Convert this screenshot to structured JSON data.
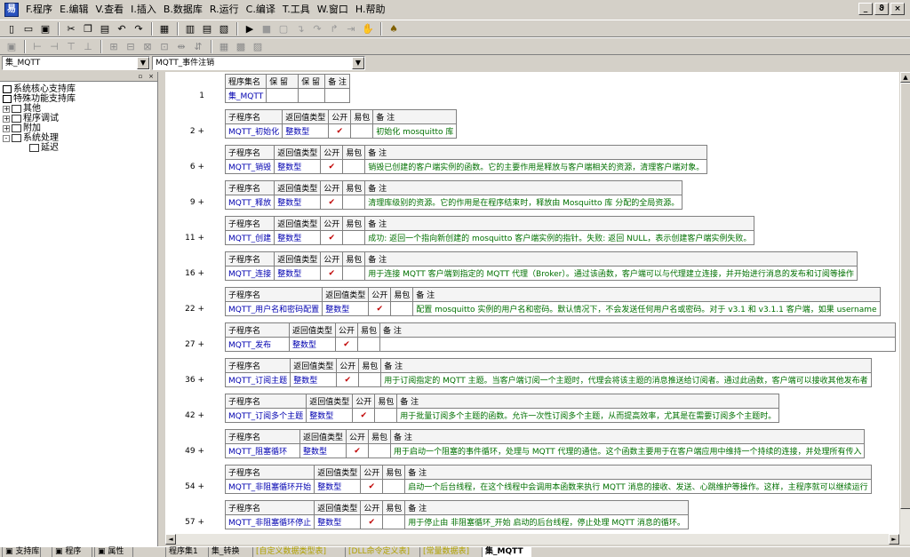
{
  "menubar": {
    "icon": "app-logo-icon",
    "items": [
      "F.程序",
      "E.编辑",
      "V.查看",
      "I.插入",
      "B.数据库",
      "R.运行",
      "C.编译",
      "T.工具",
      "W.窗口",
      "H.帮助"
    ],
    "window_controls": [
      "_",
      "ϑ",
      "×"
    ]
  },
  "combos": {
    "left": "集_MQTT",
    "right": "MQTT_事件注销"
  },
  "tree": {
    "items": [
      {
        "label": "系统核心支持库",
        "level": 0,
        "expander": ""
      },
      {
        "label": "特殊功能支持库",
        "level": 0,
        "expander": ""
      },
      {
        "label": "其他",
        "level": 0,
        "expander": "+"
      },
      {
        "label": "程序调试",
        "level": 0,
        "expander": "+"
      },
      {
        "label": "附加",
        "level": 0,
        "expander": "+"
      },
      {
        "label": "系统处理",
        "level": 0,
        "expander": "-"
      },
      {
        "label": "延迟",
        "level": 1,
        "expander": ""
      }
    ]
  },
  "editor": {
    "set_header": [
      "程序集名",
      "保 留",
      "保 留",
      "备 注"
    ],
    "set_row": {
      "line": "1",
      "name": "集_MQTT"
    },
    "sub_header": [
      "子程序名",
      "返回值类型",
      "公开",
      "易包",
      "备 注"
    ],
    "check_mark": "✔",
    "subs": [
      {
        "line": "2 +",
        "name": "MQTT_初始化",
        "ret": "整数型",
        "note": "初始化 mosquitto 库"
      },
      {
        "line": "6 +",
        "name": "MQTT_销毁",
        "ret": "整数型",
        "note": "销毁已创建的客户端实例的函数。它的主要作用是释放与客户端相关的资源，清理客户端对象。"
      },
      {
        "line": "9 +",
        "name": "MQTT_释放",
        "ret": "整数型",
        "note": "清理库级别的资源。它的作用是在程序结束时，释放由 Mosquitto 库 分配的全局资源。"
      },
      {
        "line": "11 +",
        "name": "MQTT_创建",
        "ret": "整数型",
        "note": "成功: 返回一个指向新创建的 mosquitto 客户端实例的指针。失败: 返回 NULL，表示创建客户端实例失败。"
      },
      {
        "line": "16 +",
        "name": "MQTT_连接",
        "ret": "整数型",
        "note": "用于连接 MQTT 客户端到指定的 MQTT 代理（Broker）。通过该函数，客户端可以与代理建立连接，并开始进行消息的发布和订阅等操作"
      },
      {
        "line": "22 +",
        "name": "MQTT_用户名和密码配置",
        "ret": "整数型",
        "note": "配置 mosquitto 实例的用户名和密码。默认情况下，不会发送任何用户名或密码。对于 v3.1 和 v3.1.1 客户端，如果 username"
      },
      {
        "line": "27 +",
        "name": "MQTT_发布",
        "ret": "整数型",
        "note": ""
      },
      {
        "line": "36 +",
        "name": "MQTT_订阅主题",
        "ret": "整数型",
        "note": "用于订阅指定的 MQTT 主题。当客户端订阅一个主题时，代理会将该主题的消息推送给订阅者。通过此函数，客户端可以接收其他发布者"
      },
      {
        "line": "42 +",
        "name": "MQTT_订阅多个主题",
        "ret": "整数型",
        "note": "用于批量订阅多个主题的函数。允许一次性订阅多个主题，从而提高效率，尤其是在需要订阅多个主题时。"
      },
      {
        "line": "49 +",
        "name": "MQTT_阻塞循环",
        "ret": "整数型",
        "note": "用于启动一个阻塞的事件循环，处理与 MQTT 代理的通信。这个函数主要用于在客户端应用中维持一个持续的连接，并处理所有传入"
      },
      {
        "line": "54 +",
        "name": "MQTT_非阻塞循环开始",
        "ret": "整数型",
        "note": "启动一个后台线程，在这个线程中会调用本函数来执行 MQTT 消息的接收、发送、心跳维护等操作。这样，主程序就可以继续运行"
      },
      {
        "line": "57 +",
        "name": "MQTT_非阻塞循环停止",
        "ret": "整数型",
        "note": "用于停止由 非阻塞循环_开始 启动的后台线程，停止处理 MQTT 消息的循环。"
      }
    ]
  },
  "left_tabs": [
    "支持库",
    "程序",
    "属性"
  ],
  "file_tabs": [
    {
      "label": "程序集1",
      "state": "normal"
    },
    {
      "label": "集_转换",
      "state": "normal"
    },
    {
      "label": "[自定义数据类型表]",
      "state": "dim"
    },
    {
      "label": "[DLL命令定义表]",
      "state": "dim"
    },
    {
      "label": "[常量数据表]",
      "state": "dim"
    },
    {
      "label": "集_MQTT",
      "state": "active"
    }
  ]
}
